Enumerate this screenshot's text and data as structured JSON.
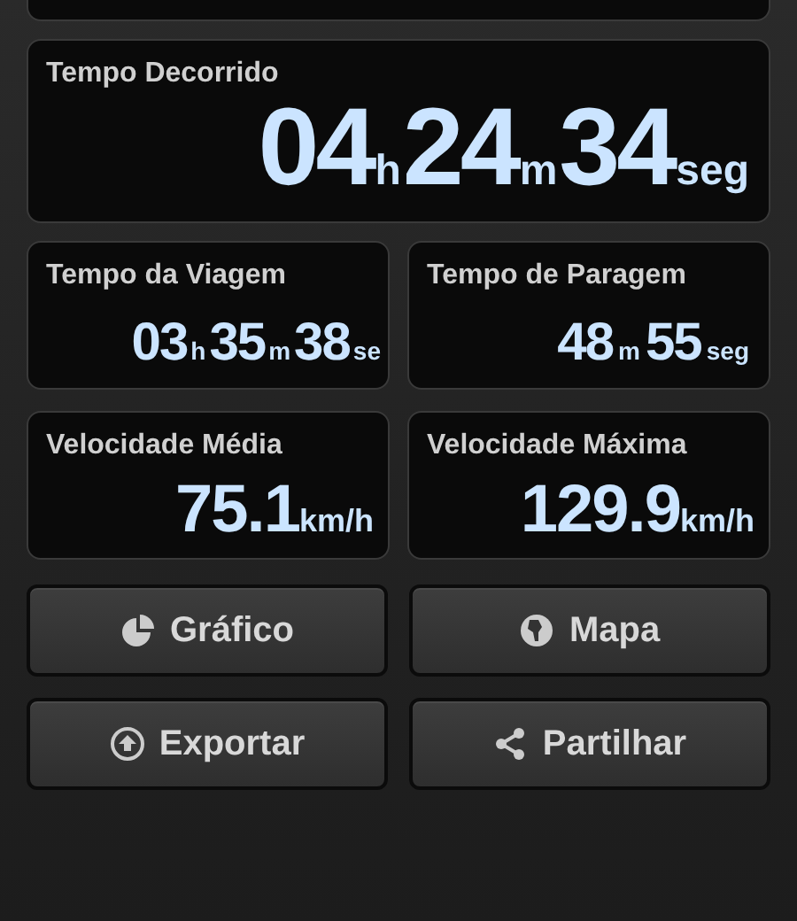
{
  "elapsed": {
    "label": "Tempo Decorrido",
    "parts": [
      {
        "value": "04",
        "unit": "h"
      },
      {
        "value": "24",
        "unit": "m"
      },
      {
        "value": "34",
        "unit": "seg"
      }
    ]
  },
  "stats": [
    {
      "label": "Tempo da Viagem",
      "parts": [
        {
          "value": "03",
          "unit": "h"
        },
        {
          "value": "35",
          "unit": "m"
        },
        {
          "value": "38",
          "unit": "se"
        }
      ]
    },
    {
      "label": "Tempo de Paragem",
      "parts": [
        {
          "value": "48",
          "unit": "m"
        },
        {
          "value": "55",
          "unit": "seg"
        }
      ]
    },
    {
      "label": "Velocidade Média",
      "parts": [
        {
          "value": "75.1",
          "unit": "km/h"
        }
      ]
    },
    {
      "label": "Velocidade Máxima",
      "parts": [
        {
          "value": "129.9",
          "unit": "km/h"
        }
      ]
    }
  ],
  "buttons": [
    {
      "label": "Gráfico",
      "kind": "chart"
    },
    {
      "label": "Mapa",
      "kind": "map"
    },
    {
      "label": "Exportar",
      "kind": "export"
    },
    {
      "label": "Partilhar",
      "kind": "share"
    }
  ]
}
